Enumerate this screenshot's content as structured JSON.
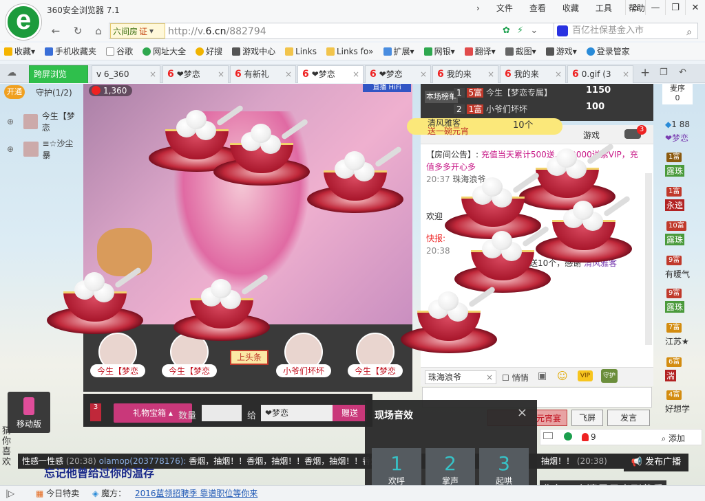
{
  "window": {
    "title": "360安全浏览器 7.1",
    "menus": [
      "文件",
      "查看",
      "收藏",
      "工具",
      "帮助"
    ]
  },
  "address": {
    "site_name": "六间房",
    "cert": "证",
    "url_host": "http://v.",
    "url_domain": "6.cn",
    "url_path": "/882794",
    "search_placeholder": "百亿社保基金入市"
  },
  "bookmarks": [
    "收藏",
    "手机收藏夹",
    "谷歌",
    "网址大全",
    "好搜",
    "游戏中心",
    "Links",
    "Links fo",
    "扩展",
    "网银",
    "翻译",
    "截图",
    "游戏",
    "登录管家"
  ],
  "tabs": [
    {
      "label": "跨屏浏览"
    },
    {
      "label": "v 6_360"
    },
    {
      "label": "❤梦恋"
    },
    {
      "label": "有新礼"
    },
    {
      "label": "❤梦恋"
    },
    {
      "label": "❤梦恋"
    },
    {
      "label": "我的来"
    },
    {
      "label": "我的来"
    },
    {
      "label": "0.gif (3"
    }
  ],
  "guard": {
    "open_label": "开通",
    "title": "守护(1/2)",
    "members": [
      "今生【梦恋",
      "≡☆沙尘暴"
    ]
  },
  "stage": {
    "coins": "1,360",
    "live_tag": "直播 HiFi"
  },
  "anchors": [
    {
      "name": "今生【梦恋"
    },
    {
      "name": "今生【梦恋"
    },
    {
      "name": "小爷们坏坏"
    },
    {
      "name": "今生【梦恋"
    }
  ],
  "headline_label": "上头条",
  "gift_bar": {
    "box_label": "礼物宝箱",
    "qty_label": "数量",
    "to_label": "给",
    "target": "❤梦恋",
    "send_label": "赠送"
  },
  "mobile_label": "移动版",
  "guess_label": "猜你喜欢",
  "rank": {
    "side_label": "本场榜单",
    "rows": [
      {
        "rank": "1",
        "badge": "5富",
        "name": "今生【梦恋专属】",
        "score": "1150"
      },
      {
        "rank": "2",
        "badge": "1富",
        "name": "小爷们坏坏",
        "score": "100"
      }
    ]
  },
  "gift_banner": {
    "sender": "清风雅客",
    "gift": "送一碗元宵",
    "count": "10个"
  },
  "chat": {
    "games_tab": "游戏",
    "badge": "3",
    "announcement_label": "【房间公告】:",
    "announcement": "充值当天累计500送...值2000送紫VIP，充值多多开心多",
    "line1_time": "20:37",
    "line1_name": "珠海浪爷",
    "welcome": "欢迎",
    "flash_label": "快报:",
    "line2_time": "20:38",
    "line2_text": "送10个，感谢",
    "line2_name": "清风雅客"
  },
  "chat_input": {
    "target": "珠海浪爷",
    "quiet_label": "悄悄",
    "vip_label": "VIP",
    "guard_label": "守护",
    "feast_label": "元宵宴",
    "fly_label": "飞屏",
    "speak_label": "发言",
    "count": "9",
    "add_label": "添加"
  },
  "right_col": {
    "order_label": "麦序",
    "order_count": "0",
    "items": [
      {
        "tag": "1",
        "text": "88"
      },
      {
        "tag": "",
        "text": "❤梦恋"
      },
      {
        "tag": "1富",
        "text": "露珠"
      },
      {
        "tag": "1富",
        "text": "永逵"
      },
      {
        "tag": "10富",
        "text": "露珠"
      },
      {
        "tag": "9富",
        "text": "有暖气"
      },
      {
        "tag": "9富",
        "text": "露珠"
      },
      {
        "tag": "7富",
        "text": "江苏★"
      },
      {
        "tag": "6富",
        "text": "湍"
      },
      {
        "tag": "4富",
        "text": "好想学"
      }
    ]
  },
  "sound_panel": {
    "title": "现场音效",
    "keys": [
      {
        "num": "1",
        "label": "欢呼"
      },
      {
        "num": "2",
        "label": "掌声"
      },
      {
        "num": "3",
        "label": "起哄"
      }
    ]
  },
  "ticker": {
    "lead": "性感一性感",
    "lead_time": "(20:38)",
    "name": "olamop(203778176):",
    "text": "香烟，抽烟！！香烟，抽烟！！香烟，抽烟！！香烟，抽烟",
    "end": "抽烟！！",
    "end_time": "(20:38)",
    "broadcast_label": "发布广播"
  },
  "captions": {
    "left": "忘记他曾给过你的温存",
    "right": "你每一个清晨日出到黄昏"
  },
  "status": {
    "deal": "今日特卖",
    "magic": "魔方：",
    "link": "2016蓝领招聘季 靠谱职位等你来"
  }
}
